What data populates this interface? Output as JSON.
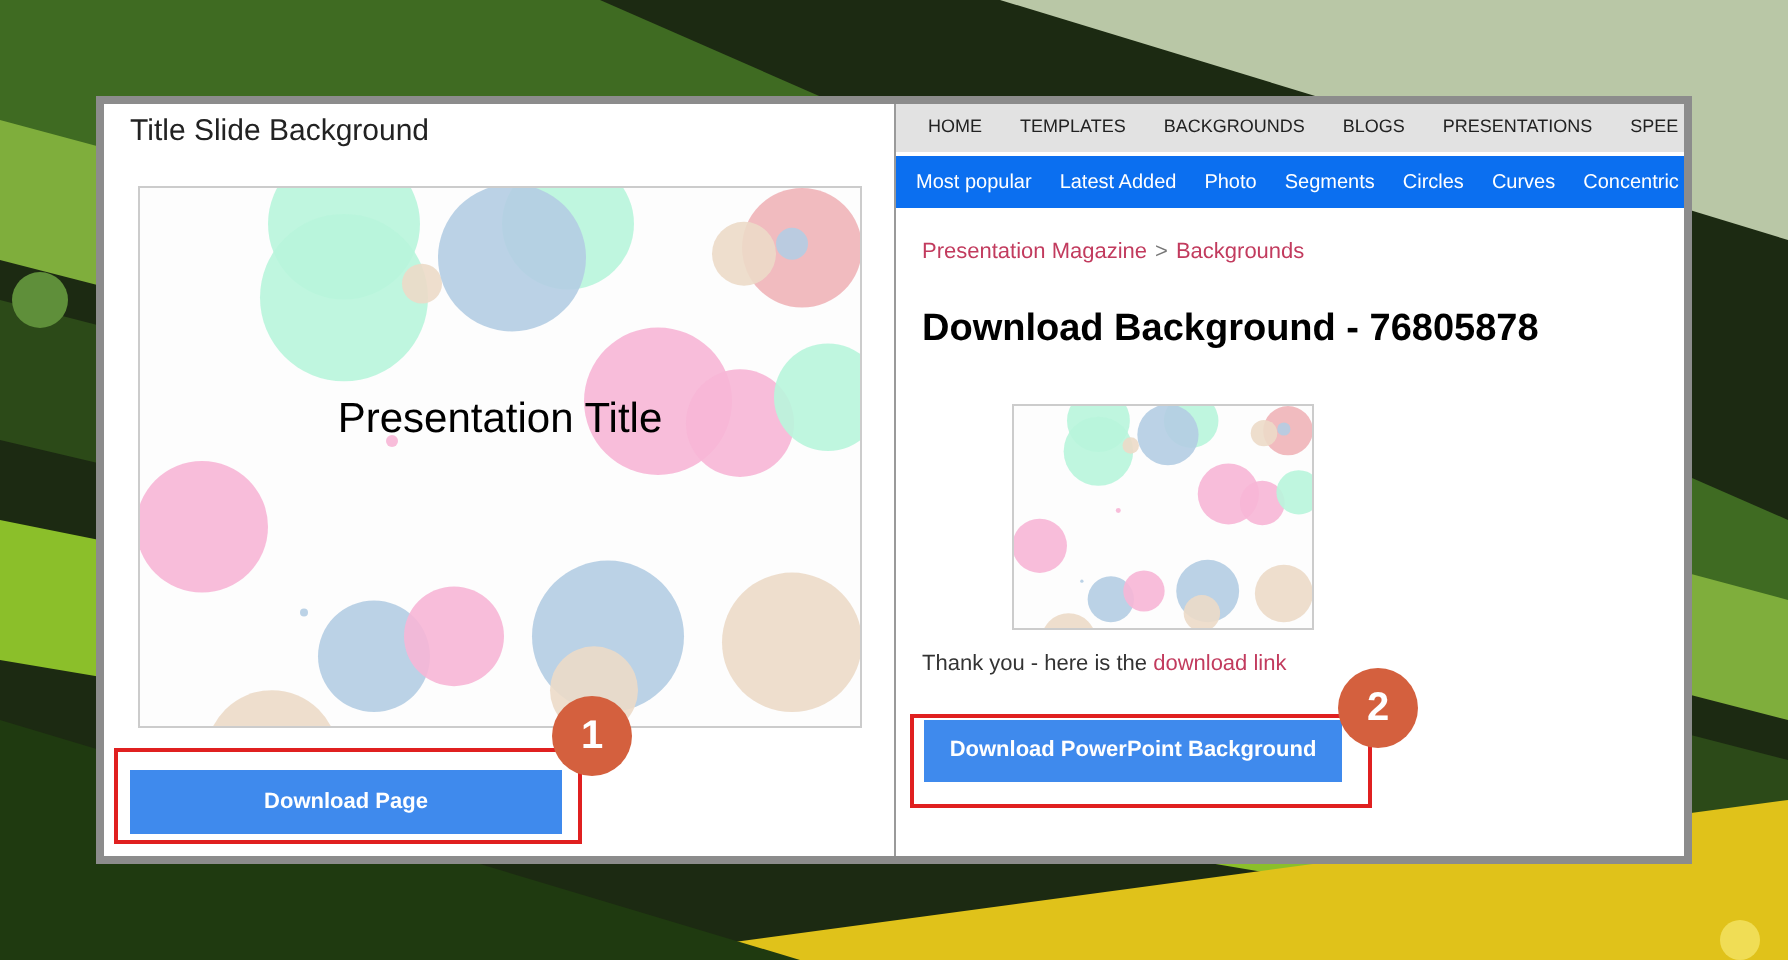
{
  "left_panel": {
    "title": "Title Slide Background",
    "slide_title": "Presentation Title",
    "button": "Download Page",
    "callout": "1"
  },
  "right_panel": {
    "nav": [
      "HOME",
      "TEMPLATES",
      "BACKGROUNDS",
      "BLOGS",
      "PRESENTATIONS",
      "SPEE"
    ],
    "categories": [
      "Most popular",
      "Latest Added",
      "Photo",
      "Segments",
      "Circles",
      "Curves",
      "Concentric"
    ],
    "breadcrumb": [
      "Presentation Magazine",
      "Backgrounds"
    ],
    "breadcrumb_separator": ">",
    "heading": "Download Background - 76805878",
    "message": "Thank you - here is the",
    "message_link": "download link",
    "button": "Download PowerPoint Background",
    "callout": "2"
  }
}
